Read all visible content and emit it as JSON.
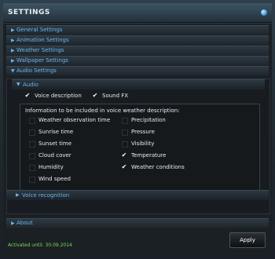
{
  "window": {
    "title": "SETTINGS"
  },
  "sections": [
    {
      "label": "General Settings",
      "arrow": "▶"
    },
    {
      "label": "Animation Settings",
      "arrow": "▶"
    },
    {
      "label": "Weather Settings",
      "arrow": "▶"
    },
    {
      "label": "Wallpaper Settings",
      "arrow": "▶"
    },
    {
      "label": "Audio Settings",
      "arrow": "▼"
    }
  ],
  "audio": {
    "header": {
      "label": "Audio",
      "arrow": "▼"
    },
    "voice_description": {
      "label": "Voice description",
      "checked": true
    },
    "sound_fx": {
      "label": "Sound FX",
      "checked": true
    },
    "info_title": "Information to be included in voice weather description:",
    "options_left": [
      {
        "label": "Weather observation time",
        "checked": false
      },
      {
        "label": "Sunrise time",
        "checked": false
      },
      {
        "label": "Sunset time",
        "checked": false
      },
      {
        "label": "Cloud cover",
        "checked": false
      },
      {
        "label": "Humidity",
        "checked": false
      },
      {
        "label": "Wind speed",
        "checked": false
      }
    ],
    "options_right": [
      {
        "label": "Precipitation",
        "checked": false
      },
      {
        "label": "Pressure",
        "checked": false
      },
      {
        "label": "Visibility",
        "checked": false
      },
      {
        "label": "Temperature",
        "checked": true
      },
      {
        "label": "Weather conditions",
        "checked": true
      }
    ]
  },
  "voice_recognition": {
    "label": "Voice recognition",
    "arrow": "▶"
  },
  "about": {
    "label": "About",
    "arrow": "▶"
  },
  "footer": {
    "activation": "Activated until: 30.09.2014"
  },
  "buttons": {
    "apply": "Apply"
  },
  "icons": {
    "check": "✔"
  }
}
